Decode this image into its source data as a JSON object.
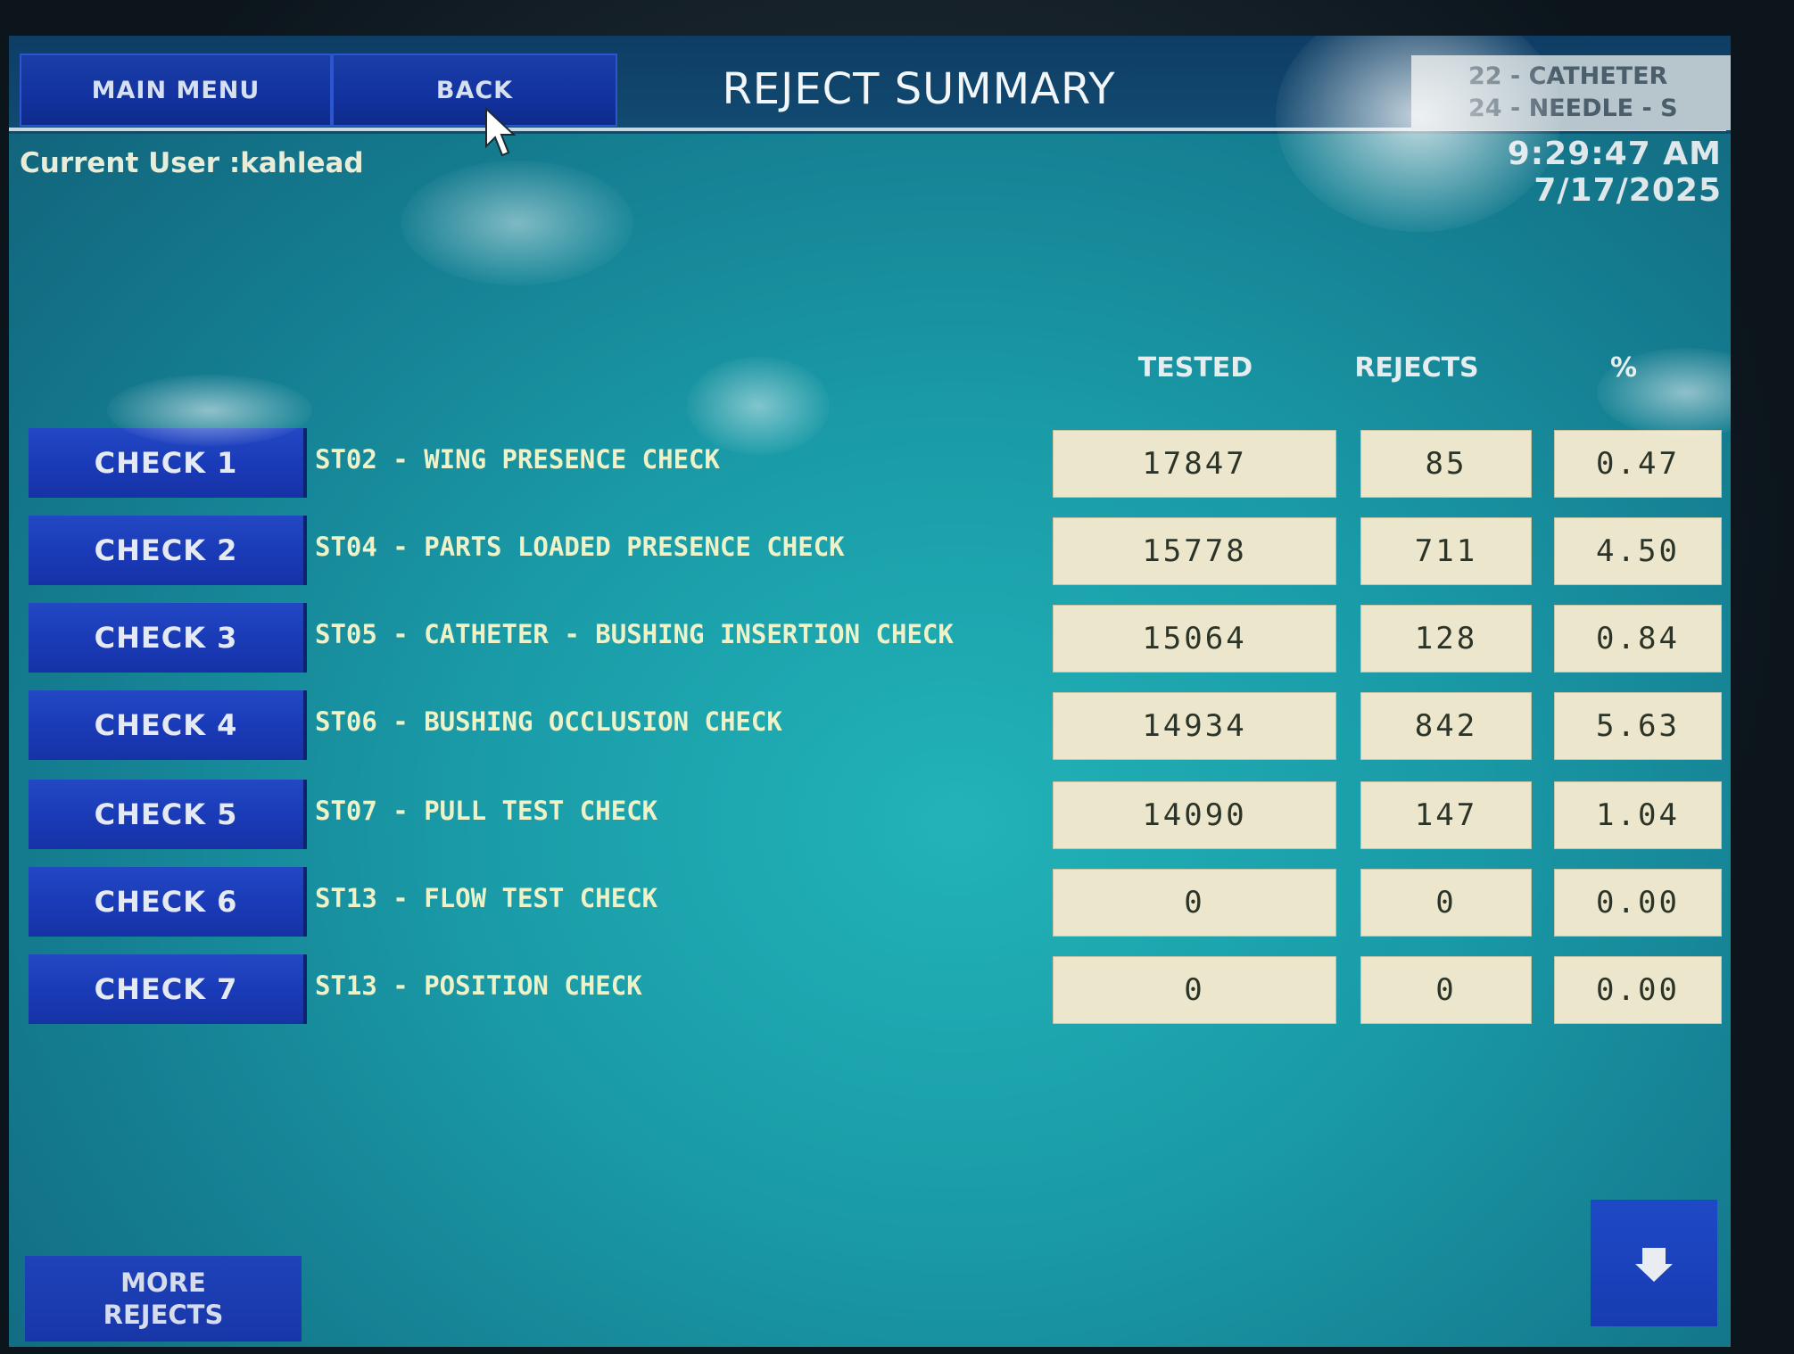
{
  "header": {
    "main_menu_label": "MAIN MENU",
    "back_label": "BACK",
    "title": "REJECT SUMMARY",
    "part_line_1": "22 - CATHETER",
    "part_line_2": "24 - NEEDLE - S",
    "current_user": "Current User :kahlead",
    "datetime": "9:29:47 AM 7/17/2025"
  },
  "columns": {
    "tested": "TESTED",
    "rejects": "REJECTS",
    "pct": "%"
  },
  "checks": [
    {
      "button": "CHECK 1",
      "description": "ST02 - WING PRESENCE CHECK",
      "tested": "17847",
      "rejects": "85",
      "pct": "0.47"
    },
    {
      "button": "CHECK 2",
      "description": "ST04 - PARTS LOADED PRESENCE CHECK",
      "tested": "15778",
      "rejects": "711",
      "pct": "4.50"
    },
    {
      "button": "CHECK 3",
      "description": "ST05 - CATHETER - BUSHING INSERTION CHECK",
      "tested": "15064",
      "rejects": "128",
      "pct": "0.84"
    },
    {
      "button": "CHECK 4",
      "description": "ST06 - BUSHING OCCLUSION CHECK",
      "tested": "14934",
      "rejects": "842",
      "pct": "5.63"
    },
    {
      "button": "CHECK 5",
      "description": "ST07 - PULL TEST CHECK",
      "tested": "14090",
      "rejects": "147",
      "pct": "1.04"
    },
    {
      "button": "CHECK 6",
      "description": "ST13 - FLOW TEST CHECK",
      "tested": "0",
      "rejects": "0",
      "pct": "0.00"
    },
    {
      "button": "CHECK 7",
      "description": "ST13 - POSITION CHECK",
      "tested": "0",
      "rejects": "0",
      "pct": "0.00"
    }
  ],
  "footer": {
    "more_rejects_line_1": "MORE",
    "more_rejects_line_2": "REJECTS",
    "down_icon": "chevron-down-icon"
  },
  "colors": {
    "screen_teal": "#1a9ca8",
    "button_blue": "#1a3bb8",
    "value_box": "#ece7cc"
  }
}
